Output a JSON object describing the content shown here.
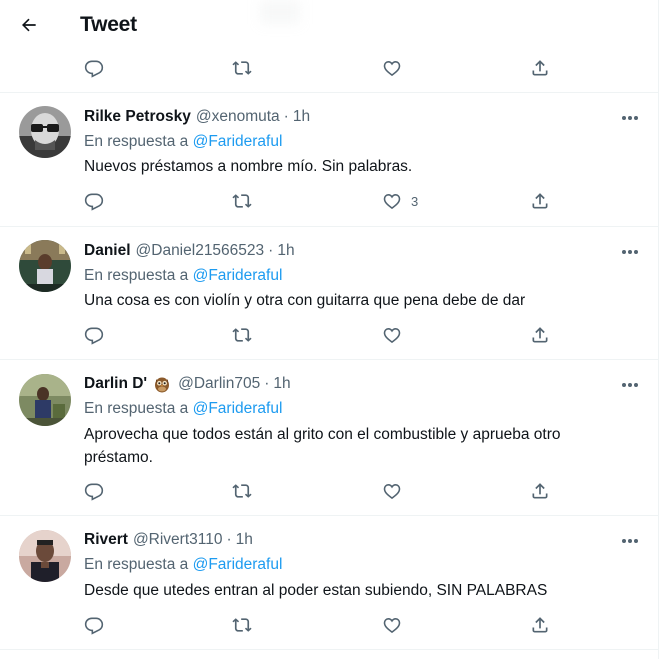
{
  "header": {
    "title": "Tweet"
  },
  "reply_prefix": "En respuesta a",
  "reply_mention": "@Farideraful",
  "top_actions": {
    "like_count": ""
  },
  "tweets": [
    {
      "name": "Rilke Petrosky",
      "handle": "@xenomuta",
      "dot": "·",
      "time": "1h",
      "text": "Nuevos préstamos a nombre mío. Sin palabras.",
      "like_count": "3"
    },
    {
      "name": "Daniel",
      "handle": "@Daniel21566523",
      "dot": "·",
      "time": "1h",
      "text": "Una cosa es con violín y otra con guitarra que pena debe de dar",
      "like_count": ""
    },
    {
      "name": "Darlin D'",
      "emoji": "owl-emoji",
      "handle": "@Darlin705",
      "dot": "·",
      "time": "1h",
      "text": "Aprovecha que todos están al grito con el combustible y aprueba otro préstamo.",
      "like_count": ""
    },
    {
      "name": "Rivert",
      "handle": "@Rivert3110",
      "dot": "·",
      "time": "1h",
      "text": "Desde que utedes entran al poder estan subiendo, SIN PALABRAS",
      "like_count": ""
    }
  ],
  "colors": {
    "accent": "#1d9bf0",
    "secondary_text": "#536471",
    "border": "#eff3f4"
  }
}
